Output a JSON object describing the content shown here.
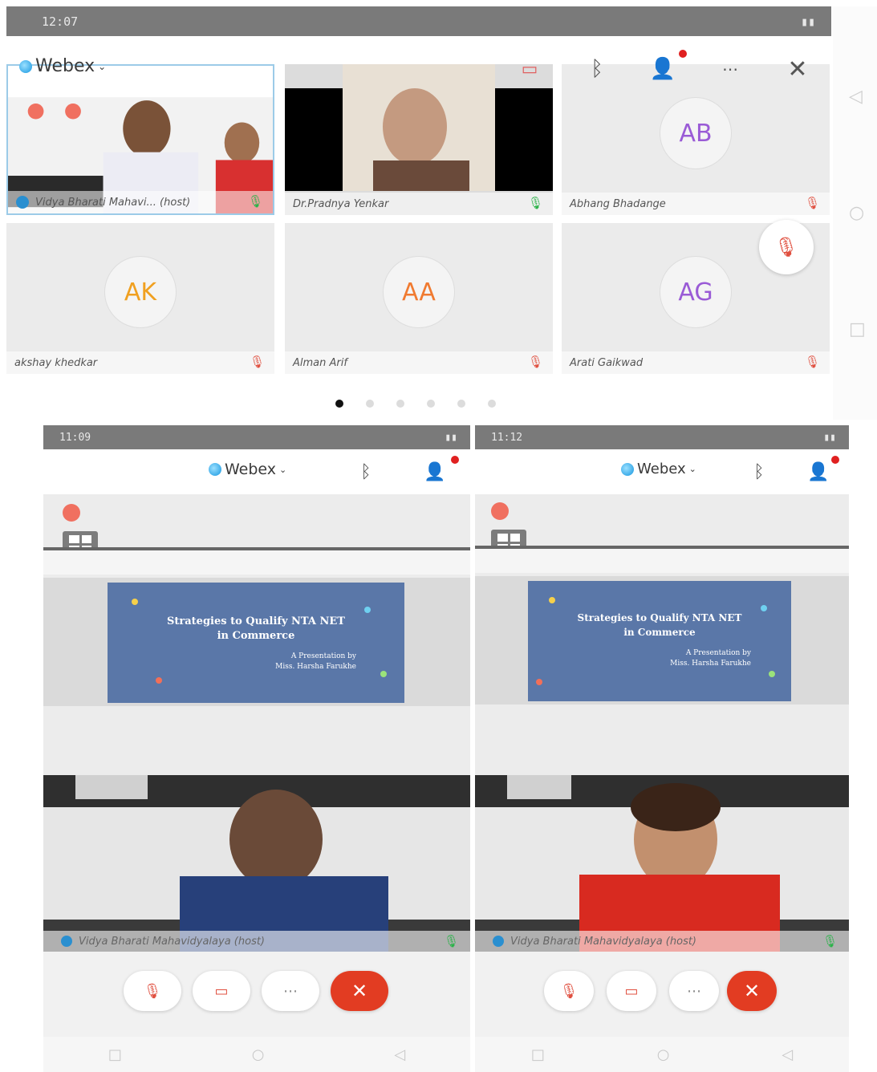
{
  "top_screen": {
    "status": {
      "time": "12:07",
      "right": ""
    },
    "app": "Webex",
    "tiles": [
      {
        "name": "Vidya Bharati Mahavi... (host)",
        "type": "video",
        "mic": "on"
      },
      {
        "name": "Dr.Pradnya Yenkar",
        "type": "video",
        "mic": "on"
      },
      {
        "name": "Abhang Bhadange",
        "initials": "AB",
        "initials_color": "#9a5bd6",
        "mic": "muted"
      },
      {
        "name": "akshay khedkar",
        "initials": "AK",
        "initials_color": "#f0a020",
        "mic": "muted"
      },
      {
        "name": "Alman Arif",
        "initials": "AA",
        "initials_color": "#f07a30",
        "mic": "muted"
      },
      {
        "name": "Arati Gaikwad",
        "initials": "AG",
        "initials_color": "#9a5bd6",
        "mic": "muted"
      }
    ],
    "pager": {
      "count": 6,
      "active": 0
    }
  },
  "left_screen": {
    "status": {
      "time": "11:09"
    },
    "app": "Webex",
    "slide": {
      "title_line1": "Strategies to Qualify NTA NET",
      "title_line2": "in Commerce",
      "byline1": "A Presentation by",
      "byline2": "Miss. Harsha Farukhe"
    },
    "speaker_name": "Vidya Bharati Mahavidyalaya (host)"
  },
  "right_screen": {
    "status": {
      "time": "11:12"
    },
    "app": "Webex",
    "slide": {
      "title_line1": "Strategies to Qualify NTA NET",
      "title_line2": "in Commerce",
      "byline1": "A Presentation by",
      "byline2": "Miss. Harsha Farukhe"
    },
    "speaker_name": "Vidya Bharati Mahavidyalaya (host)"
  },
  "icons": {
    "mic_muted": "mic-muted-icon",
    "mic_on": "mic-icon",
    "bluetooth": "bluetooth-icon",
    "participants": "participants-icon",
    "more": "more-icon",
    "close": "close-icon",
    "video_off": "video-off-icon",
    "end_call": "end-call-icon"
  },
  "colors": {
    "end_call": "#e23c22",
    "mic_on": "#2cb34a",
    "mic_muted": "#e05040",
    "webex_blue": "#1596e0"
  }
}
